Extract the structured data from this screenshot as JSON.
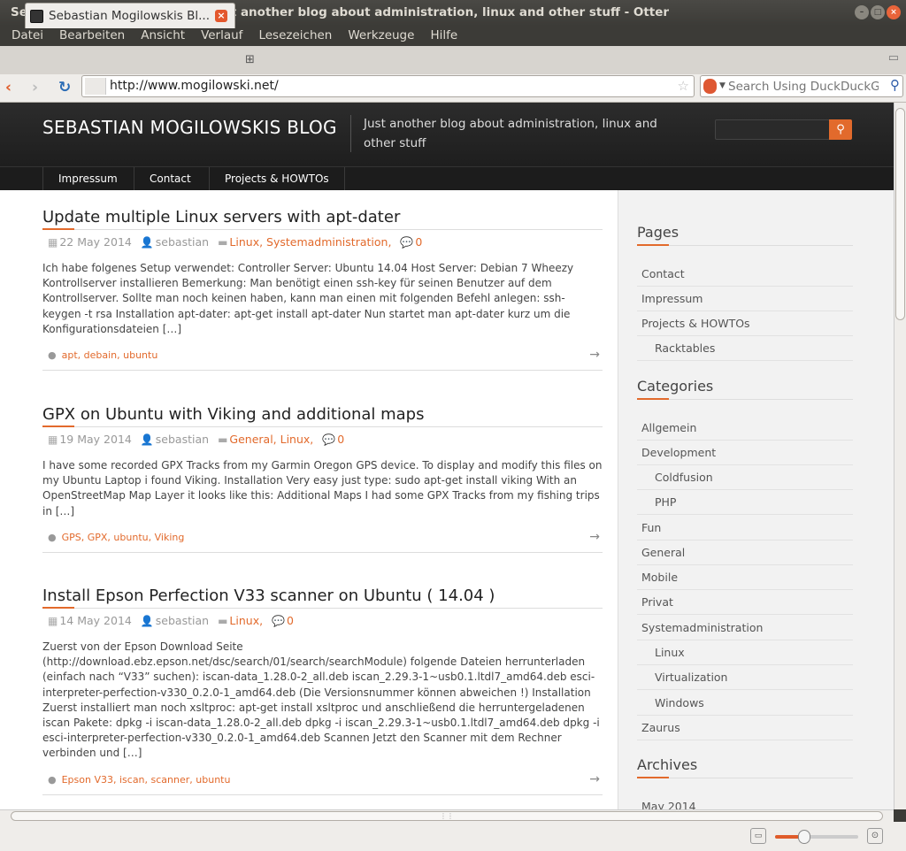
{
  "window": {
    "title": "Sebastian Mogilowskis Blog | Just another blog about administration, linux and other stuff - Otter"
  },
  "menu": [
    "Datei",
    "Bearbeiten",
    "Ansicht",
    "Verlauf",
    "Lesezeichen",
    "Werkzeuge",
    "Hilfe"
  ],
  "tab": {
    "title": "Sebastian Mogilowskis Bl..."
  },
  "address": {
    "url": "http://www.mogilowski.net/"
  },
  "search": {
    "placeholder": "Search Using DuckDuckGo"
  },
  "site": {
    "title": "SEBASTIAN MOGILOWSKIS BLOG",
    "tagline": "Just another blog about administration, linux and other stuff",
    "nav": [
      "Impressum",
      "Contact",
      "Projects & HOWTOs"
    ]
  },
  "posts": [
    {
      "title": "Update multiple Linux servers with apt-dater",
      "date": "22 May 2014",
      "author": "sebastian",
      "categories": "Linux, Systemadministration,",
      "comments": "0",
      "excerpt": "Ich habe folgenes Setup verwendet: Controller Server: Ubuntu 14.04 Host Server: Debian 7 Wheezy Kontrollserver installieren Bemerkung: Man benötigt einen ssh-key für seinen Benutzer auf dem Kontrollserver. Sollte man noch keinen haben, kann man einen mit folgenden Befehl anlegen: ssh-keygen -t rsa Installation apt-dater: apt-get install apt-dater Nun startet man apt-dater kurz um die Konfigurationsdateien […]",
      "tags": "apt, debain, ubuntu"
    },
    {
      "title": "GPX on Ubuntu with Viking and additional maps",
      "date": "19 May 2014",
      "author": "sebastian",
      "categories": "General, Linux,",
      "comments": "0",
      "excerpt": "I have some recorded GPX Tracks from my Garmin Oregon GPS device. To display and modify this files on my Ubuntu Laptop i found Viking. Installation Very easy just type: sudo apt-get install viking With an OpenStreetMap Map Layer it looks like this: Additional Maps I had some GPX Tracks from my fishing trips in […]",
      "tags": "GPS, GPX, ubuntu, Viking"
    },
    {
      "title": "Install Epson Perfection V33 scanner on Ubuntu ( 14.04 )",
      "date": "14 May 2014",
      "author": "sebastian",
      "categories": "Linux,",
      "comments": "0",
      "excerpt": "Zuerst von der Epson Download Seite (http://download.ebz.epson.net/dsc/search/01/search/searchModule) folgende Dateien herrunterladen (einfach nach “V33” suchen): iscan-data_1.28.0-2_all.deb iscan_2.29.3-1~usb0.1.ltdl7_amd64.deb esci-interpreter-perfection-v330_0.2.0-1_amd64.deb (Die Versionsnummer können abweichen !) Installation Zuerst installiert man noch xsltproc: apt-get install xsltproc und anschließend die herruntergeladenen iscan Pakete: dpkg -i iscan-data_1.28.0-2_all.deb dpkg -i iscan_2.29.3-1~usb0.1.ltdl7_amd64.deb dpkg -i esci-interpreter-perfection-v330_0.2.0-1_amd64.deb Scannen Jetzt den Scanner mit dem Rechner verbinden und […]",
      "tags": "Epson V33, iscan, scanner, ubuntu"
    }
  ],
  "sidebar": {
    "pages_title": "Pages",
    "pages": [
      "Contact",
      "Impressum",
      "Projects & HOWTOs",
      "Racktables"
    ],
    "categories_title": "Categories",
    "categories": [
      "Allgemein",
      "Development",
      "Coldfusion",
      "PHP",
      "Fun",
      "General",
      "Mobile",
      "Privat",
      "Systemadministration",
      "Linux",
      "Virtualization",
      "Windows",
      "Zaurus"
    ],
    "archives_title": "Archives",
    "archives": [
      "May 2014"
    ]
  },
  "zoom": {
    "level": 0.35
  },
  "colors": {
    "accent": "#e26a2c",
    "header": "#222222"
  }
}
